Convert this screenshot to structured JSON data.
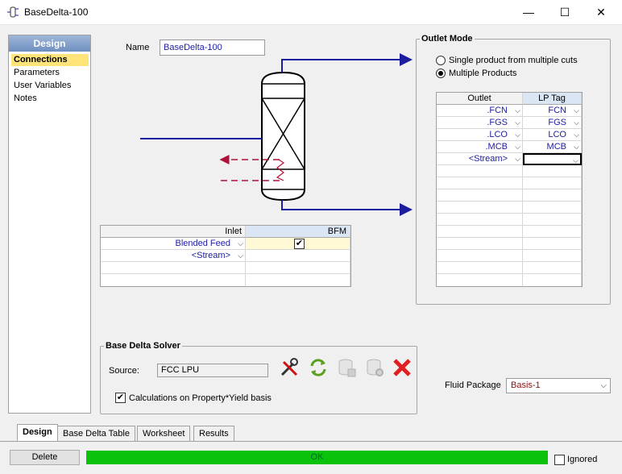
{
  "window": {
    "title": "BaseDelta-100",
    "minimize": "—",
    "maximize": "☐",
    "close": "✕"
  },
  "nav": {
    "header": "Design",
    "items": [
      {
        "label": "Connections"
      },
      {
        "label": "Parameters"
      },
      {
        "label": "User Variables"
      },
      {
        "label": "Notes"
      }
    ]
  },
  "name": {
    "label": "Name",
    "value": "BaseDelta-100"
  },
  "inlet_grid": {
    "headers": [
      "Inlet",
      "BFM"
    ],
    "rows": [
      {
        "stream": "Blended Feed",
        "bfm": "✔"
      },
      {
        "stream": "<Stream>",
        "bfm": ""
      }
    ]
  },
  "outlet_mode": {
    "title": "Outlet Mode",
    "options": [
      {
        "label": "Single product from multiple cuts",
        "selected": false
      },
      {
        "label": "Multiple Products",
        "selected": true
      }
    ]
  },
  "outlet_grid": {
    "headers": [
      "Outlet",
      "LP Tag"
    ],
    "rows": [
      {
        "outlet": ".FCN",
        "tag": "FCN"
      },
      {
        "outlet": ".FGS",
        "tag": "FGS"
      },
      {
        "outlet": ".LCO",
        "tag": "LCO"
      },
      {
        "outlet": ".MCB",
        "tag": "MCB"
      },
      {
        "outlet": "<Stream>",
        "tag": ""
      }
    ]
  },
  "solver": {
    "title": "Base Delta Solver",
    "source_label": "Source:",
    "source_value": "FCC LPU",
    "calc_label": "Calculations on Property*Yield basis",
    "calc_checked": true,
    "icons": [
      "tools-icon",
      "refresh-icon",
      "database-icon",
      "database-settings-icon",
      "delete-x-icon"
    ]
  },
  "fluid_package": {
    "label": "Fluid Package",
    "value": "Basis-1"
  },
  "tabs": [
    {
      "label": "Design",
      "active": true
    },
    {
      "label": "Base Delta Table",
      "active": false
    },
    {
      "label": "Worksheet",
      "active": false
    },
    {
      "label": "Results",
      "active": false
    }
  ],
  "footer": {
    "delete_label": "Delete",
    "status": "OK",
    "ignored_label": "Ignored"
  },
  "colors": {
    "accent_nav": "#ffe47a",
    "status_ok": "#0ac20a",
    "stream_blue": "#1c1ca0",
    "energy_red": "#b0103a"
  }
}
